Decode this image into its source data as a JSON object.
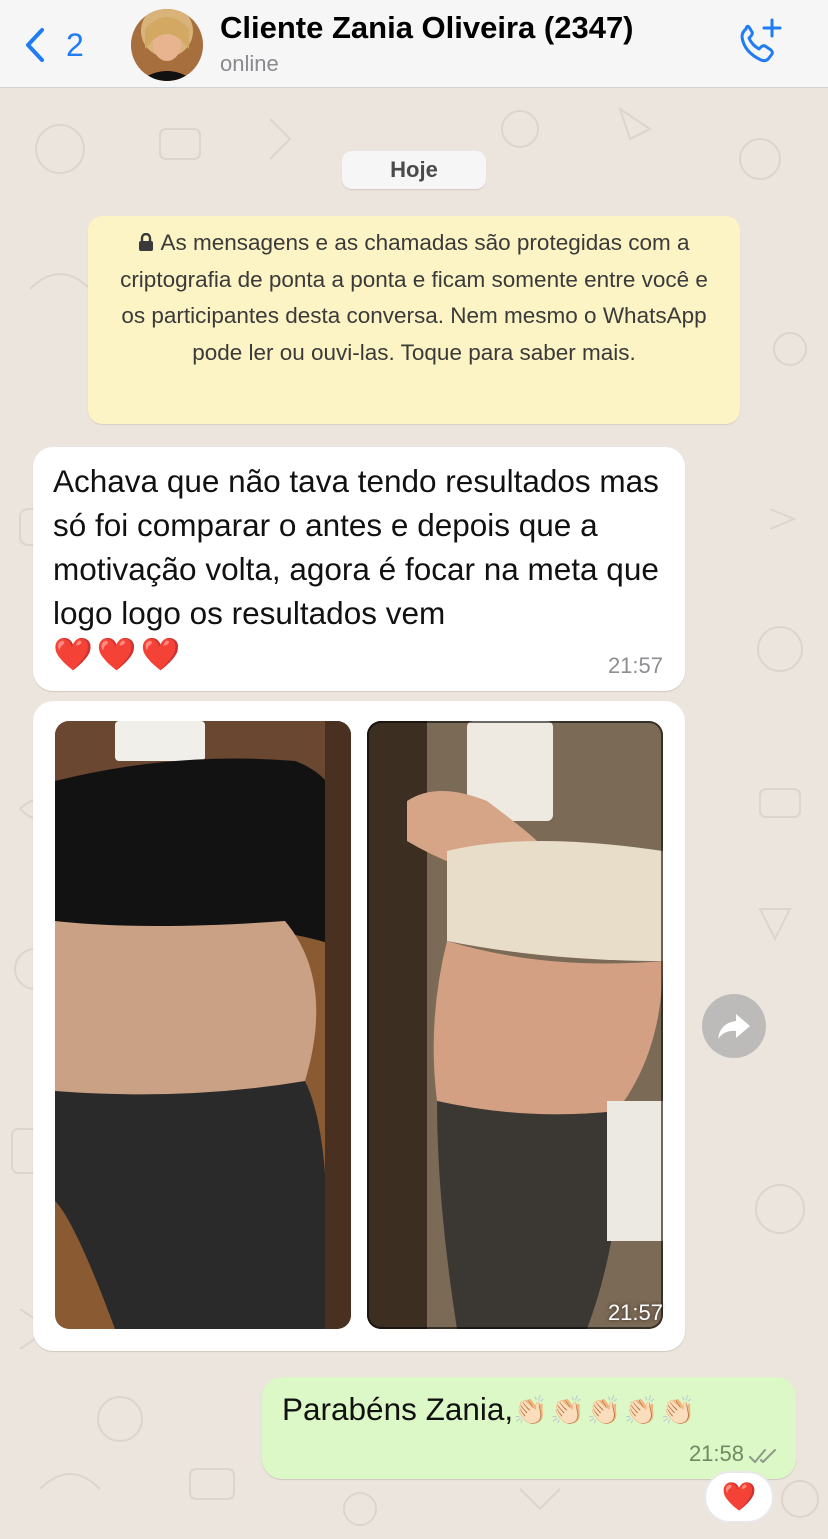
{
  "header": {
    "back_count": "2",
    "contact_name": "Cliente Zania Oliveira (2347)",
    "status": "online",
    "accent_color": "#1f7cf5"
  },
  "chat": {
    "date_pill": "Hoje",
    "encryption_notice": "As mensagens e as chamadas são protegidas com a criptografia de ponta a ponta e ficam somente entre você e os participantes desta conversa. Nem mesmo o WhatsApp pode ler ou ouvi-las. Toque para saber mais.",
    "messages": [
      {
        "direction": "incoming",
        "text": "Achava que não tava tendo resultados mas só foi comparar o antes e depois que a motivação volta, agora é focar na meta que logo logo os resultados vem",
        "emoji": "❤️❤️❤️",
        "time": "21:57"
      },
      {
        "direction": "incoming",
        "type": "image",
        "time": "21:57"
      },
      {
        "direction": "outgoing",
        "text": "Parabéns Zania,",
        "emoji": "👏🏻👏🏻👏🏻👏🏻👏🏻",
        "time": "21:58",
        "status": "read",
        "reaction": "❤️"
      }
    ]
  },
  "icons": {
    "back": "chevron-left-icon",
    "call": "phone-plus-icon",
    "lock": "lock-icon",
    "forward": "forward-icon",
    "read": "double-check-icon"
  }
}
